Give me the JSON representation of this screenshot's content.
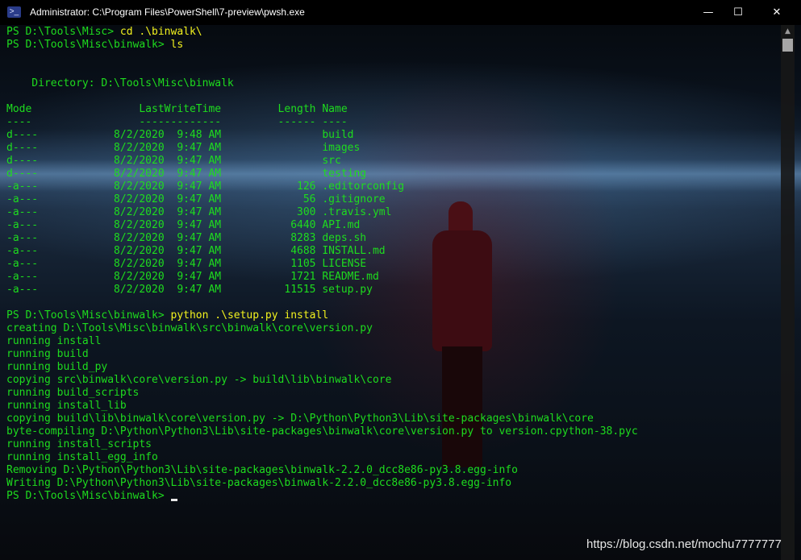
{
  "window": {
    "title": "Administrator: C:\\Program Files\\PowerShell\\7-preview\\pwsh.exe",
    "app_icon": "powershell-icon",
    "controls": {
      "minimize": "—",
      "maximize": "☐",
      "close": "✕"
    }
  },
  "colors": {
    "output": "#1edc1e",
    "command": "#f2f21e",
    "titlebar": "#000000",
    "cursor": "#e8e8e8"
  },
  "terminal": {
    "lines": [
      {
        "prompt": "PS D:\\Tools\\Misc> ",
        "command": "cd .\\binwalk\\"
      },
      {
        "prompt": "PS D:\\Tools\\Misc\\binwalk> ",
        "command": "ls"
      },
      {
        "text": ""
      },
      {
        "text": ""
      },
      {
        "text": "    Directory: D:\\Tools\\Misc\\binwalk"
      },
      {
        "text": ""
      },
      {
        "text": "Mode                 LastWriteTime         Length Name"
      },
      {
        "text": "----                 -------------         ------ ----"
      },
      {
        "text": "d----            8/2/2020  9:48 AM                build"
      },
      {
        "text": "d----            8/2/2020  9:47 AM                images"
      },
      {
        "text": "d----            8/2/2020  9:47 AM                src"
      },
      {
        "text": "d----            8/2/2020  9:47 AM                testing"
      },
      {
        "text": "-a---            8/2/2020  9:47 AM            126 .editorconfig"
      },
      {
        "text": "-a---            8/2/2020  9:47 AM             56 .gitignore"
      },
      {
        "text": "-a---            8/2/2020  9:47 AM            300 .travis.yml"
      },
      {
        "text": "-a---            8/2/2020  9:47 AM           6440 API.md"
      },
      {
        "text": "-a---            8/2/2020  9:47 AM           8283 deps.sh"
      },
      {
        "text": "-a---            8/2/2020  9:47 AM           4688 INSTALL.md"
      },
      {
        "text": "-a---            8/2/2020  9:47 AM           1105 LICENSE"
      },
      {
        "text": "-a---            8/2/2020  9:47 AM           1721 README.md"
      },
      {
        "text": "-a---            8/2/2020  9:47 AM          11515 setup.py"
      },
      {
        "text": ""
      },
      {
        "prompt": "PS D:\\Tools\\Misc\\binwalk> ",
        "command": "python .\\setup.py install"
      },
      {
        "text": "creating D:\\Tools\\Misc\\binwalk\\src\\binwalk\\core\\version.py"
      },
      {
        "text": "running install"
      },
      {
        "text": "running build"
      },
      {
        "text": "running build_py"
      },
      {
        "text": "copying src\\binwalk\\core\\version.py -> build\\lib\\binwalk\\core"
      },
      {
        "text": "running build_scripts"
      },
      {
        "text": "running install_lib"
      },
      {
        "text": "copying build\\lib\\binwalk\\core\\version.py -> D:\\Python\\Python3\\Lib\\site-packages\\binwalk\\core"
      },
      {
        "text": "byte-compiling D:\\Python\\Python3\\Lib\\site-packages\\binwalk\\core\\version.py to version.cpython-38.pyc"
      },
      {
        "text": "running install_scripts"
      },
      {
        "text": "running install_egg_info"
      },
      {
        "text": "Removing D:\\Python\\Python3\\Lib\\site-packages\\binwalk-2.2.0_dcc8e86-py3.8.egg-info"
      },
      {
        "text": "Writing D:\\Python\\Python3\\Lib\\site-packages\\binwalk-2.2.0_dcc8e86-py3.8.egg-info"
      },
      {
        "prompt": "PS D:\\Tools\\Misc\\binwalk> ",
        "command": "",
        "cursor": true
      }
    ]
  },
  "scrollbar": {
    "up_arrow": "▲"
  },
  "watermark": "https://blog.csdn.net/mochu7777777"
}
